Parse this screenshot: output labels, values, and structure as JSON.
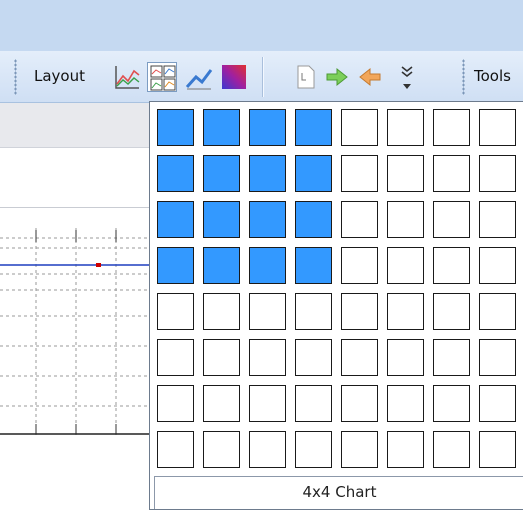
{
  "toolbar": {
    "layout_label": "Layout",
    "tools_label": "Tools",
    "buttons": [
      {
        "name": "line-chart-icon"
      },
      {
        "name": "chart-grid-layout-icon",
        "pressed": true
      },
      {
        "name": "trend-chart-icon"
      },
      {
        "name": "color-gradient-icon"
      },
      {
        "name": "document-icon"
      },
      {
        "name": "arrow-right-icon"
      },
      {
        "name": "arrow-left-icon"
      },
      {
        "name": "overflow-chevron-icon"
      }
    ]
  },
  "grid_picker": {
    "rows": 8,
    "columns": 8,
    "selected_rows": 4,
    "selected_columns": 4,
    "caption": "4x4 Chart",
    "colors": {
      "selected": "#3399ff",
      "unselected": "#ffffff",
      "border": "#1a1a1a"
    }
  },
  "colors": {
    "toolbar_band": "#c5d9f1",
    "chart_line": "#1f3fbf",
    "chart_marker": "#cc0000"
  }
}
